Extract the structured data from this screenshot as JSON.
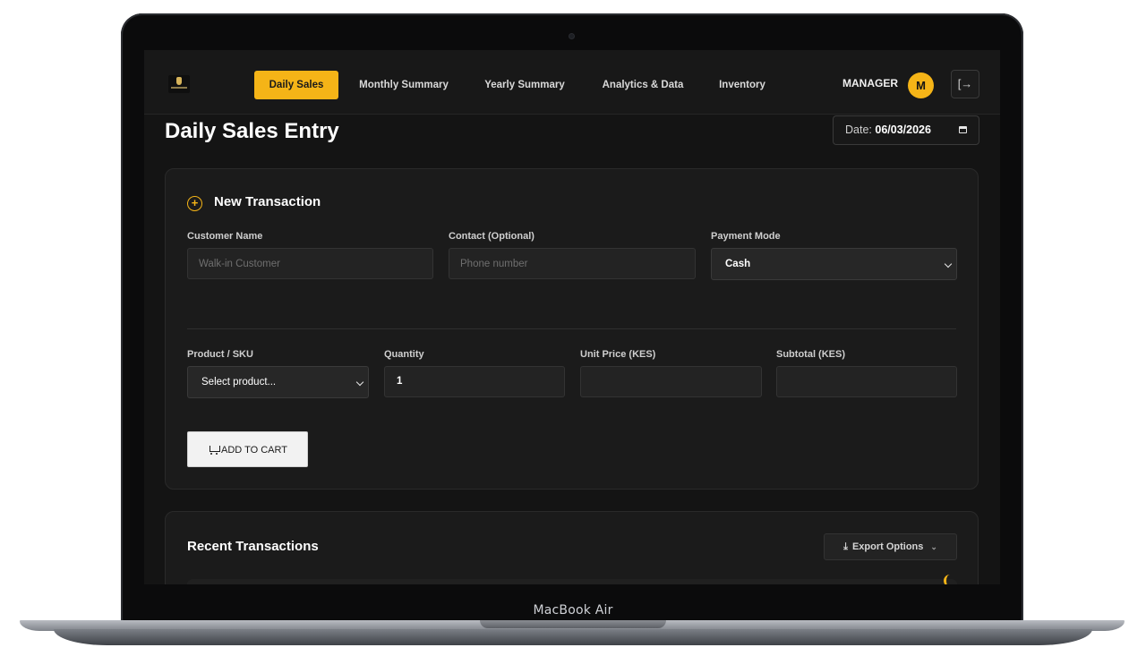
{
  "device": {
    "label": "MacBook Air"
  },
  "header": {
    "tabs": [
      {
        "label": "Daily Sales",
        "active": true
      },
      {
        "label": "Monthly Summary",
        "active": false
      },
      {
        "label": "Yearly Summary",
        "active": false
      },
      {
        "label": "Analytics & Data",
        "active": false
      },
      {
        "label": "Inventory",
        "active": false
      }
    ],
    "role": "MANAGER",
    "avatar_initial": "M"
  },
  "page": {
    "title": "Daily Sales Entry",
    "date_label": "Date:",
    "date_value": "06/03/2026"
  },
  "transaction": {
    "title": "New Transaction",
    "customer_label": "Customer Name",
    "customer_placeholder": "Walk-in Customer",
    "contact_label": "Contact (Optional)",
    "contact_placeholder": "Phone number",
    "payment_label": "Payment Mode",
    "payment_value": "Cash",
    "product_label": "Product / SKU",
    "product_value": "Select product...",
    "quantity_label": "Quantity",
    "quantity_value": "1",
    "unit_price_label": "Unit Price (KES)",
    "unit_price_value": "",
    "subtotal_label": "Subtotal (KES)",
    "subtotal_value": "",
    "add_button": "ADD TO CART"
  },
  "recent": {
    "title": "Recent Transactions",
    "export_label": "Export Options"
  },
  "colors": {
    "accent": "#f5b417",
    "background": "#141414",
    "card": "#1b1b1b"
  }
}
